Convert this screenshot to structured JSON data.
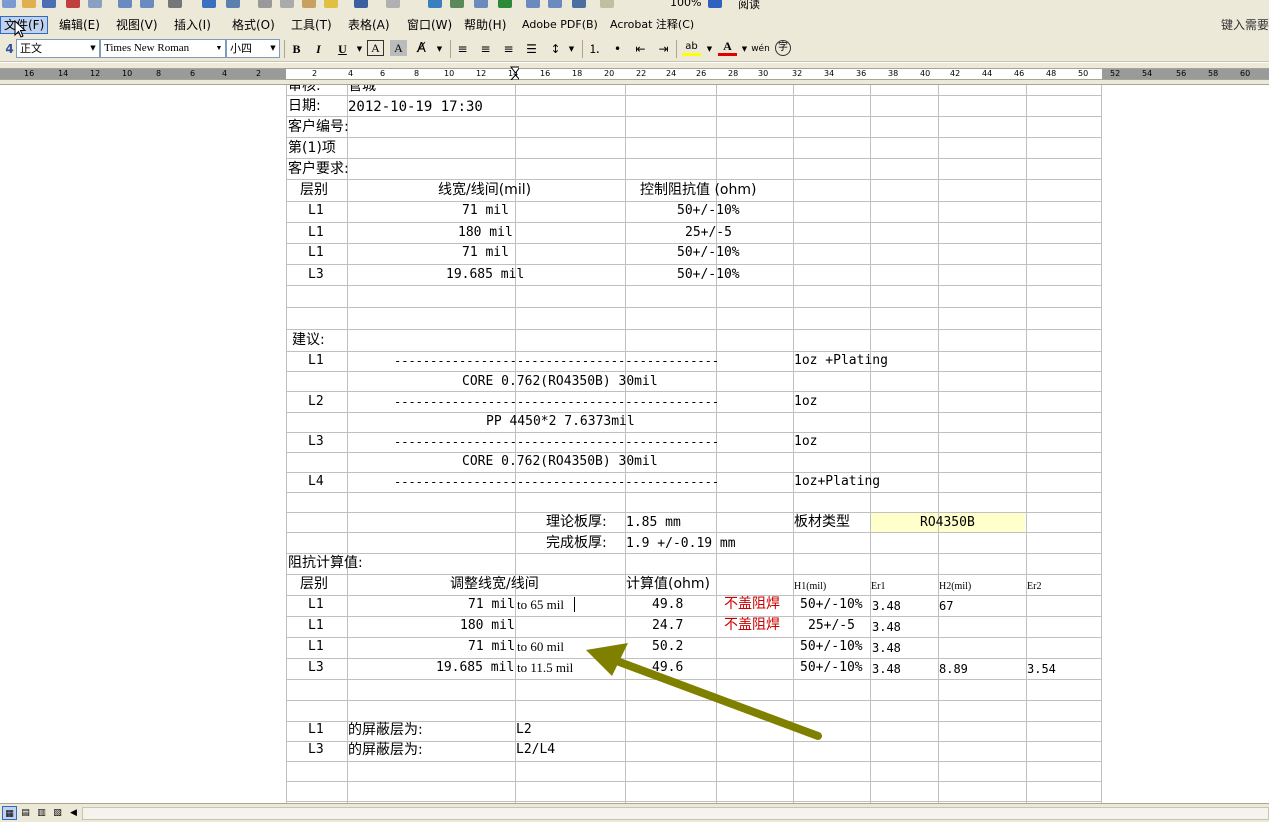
{
  "toolbar_top": {
    "zoom": "100%",
    "reading_label": "阅读"
  },
  "menubar": {
    "items": [
      {
        "label": "文件(F)"
      },
      {
        "label": "编辑(E)"
      },
      {
        "label": "视图(V)"
      },
      {
        "label": "插入(I)"
      },
      {
        "label": "格式(O)"
      },
      {
        "label": "工具(T)"
      },
      {
        "label": "表格(A)"
      },
      {
        "label": "窗口(W)"
      },
      {
        "label": "帮助(H)"
      },
      {
        "label": "Adobe PDF(B)"
      },
      {
        "label": "Acrobat 注释(C)"
      }
    ],
    "ask_placeholder": "键入需要"
  },
  "format_toolbar": {
    "style": "正文",
    "font": "Times New Roman",
    "size": "小四",
    "bold": "B",
    "italic": "I",
    "underline": "U",
    "char_border": "A",
    "char_shade": "A",
    "font_color": "A",
    "phonetic": "wén",
    "enclose": "字"
  },
  "ruler": {
    "ticks": [
      "16",
      "14",
      "12",
      "10",
      "8",
      "6",
      "4",
      "2",
      "2",
      "4",
      "6",
      "8",
      "10",
      "12",
      "14",
      "16",
      "18",
      "20",
      "22",
      "24",
      "26",
      "28",
      "30",
      "32",
      "34",
      "36",
      "38",
      "40",
      "42",
      "44",
      "46",
      "48",
      "50",
      "52",
      "54",
      "56",
      "58",
      "60"
    ]
  },
  "document": {
    "reviewer_label": "审核:",
    "reviewer_value": "管城",
    "date_label": "日期:",
    "date_value": "2012-10-19 17:30",
    "customer_no_label": "客户编号:",
    "item_label": "第(1)项",
    "customer_req_label": "客户要求:",
    "req_headers": [
      "层别",
      "线宽/线间(mil)",
      "控制阻抗值 (ohm)"
    ],
    "req_rows": [
      {
        "layer": "L1",
        "width": "71 mil",
        "impedance": "50+/-10%"
      },
      {
        "layer": "L1",
        "width": "180 mil",
        "impedance": "25+/-5"
      },
      {
        "layer": "L1",
        "width": "71 mil",
        "impedance": "50+/-10%"
      },
      {
        "layer": "L3",
        "width": "19.685 mil",
        "impedance": "50+/-10%"
      }
    ],
    "suggest_label": "建议:",
    "stackup": [
      {
        "layer": "L1",
        "line": "---------------------------------------------",
        "copper": "1oz +Plating"
      },
      {
        "material": "CORE  0.762(RO4350B)  30mil"
      },
      {
        "layer": "L2",
        "line": "---------------------------------------------",
        "copper": "1oz"
      },
      {
        "material": "PP  4450*2  7.6373mil"
      },
      {
        "layer": "L3",
        "line": "---------------------------------------------",
        "copper": "1oz"
      },
      {
        "material": "CORE  0.762(RO4350B)  30mil"
      },
      {
        "layer": "L4",
        "line": "---------------------------------------------",
        "copper": "1oz+Plating"
      }
    ],
    "theory_thickness_label": "理论板厚:",
    "theory_thickness_value": "1.85 mm",
    "board_type_label": "板材类型",
    "board_type_value": "RO4350B",
    "finish_thickness_label": "完成板厚:",
    "finish_thickness_value": "1.9 +/-0.19 mm",
    "calc_label": "阻抗计算值:",
    "calc_headers": [
      "层别",
      "调整线宽/线间",
      "计算值(ohm)",
      "H1(mil)",
      "Er1",
      "H2(mil)",
      "Er2"
    ],
    "calc_rows": [
      {
        "layer": "L1",
        "width": "71 mil",
        "adjust": "to 65 mil",
        "value": "49.8",
        "note": "不盖阻焊",
        "target": "50+/-10%",
        "er1": "3.48",
        "h2": "67",
        "er2": ""
      },
      {
        "layer": "L1",
        "width": "180 mil",
        "adjust": "",
        "value": "24.7",
        "note": "不盖阻焊",
        "target": "25+/-5",
        "er1": "3.48",
        "h2": "",
        "er2": ""
      },
      {
        "layer": "L1",
        "width": "71 mil",
        "adjust": "to 60 mil",
        "value": "50.2",
        "note": "",
        "target": "50+/-10%",
        "er1": "3.48",
        "h2": "",
        "er2": ""
      },
      {
        "layer": "L3",
        "width": "19.685 mil",
        "adjust": "to 11.5 mil",
        "value": "49.6",
        "note": "",
        "target": "50+/-10%",
        "er1": "3.48",
        "h2": "8.89",
        "er2": "3.54"
      }
    ],
    "shield_rows": [
      {
        "layer": "L1",
        "label": "的屏蔽层为:",
        "value": "L2"
      },
      {
        "layer": "L3",
        "label": "的屏蔽层为:",
        "value": "L2/L4"
      }
    ]
  },
  "colors": {
    "chrome": "#ece9d8",
    "arrow": "#808000",
    "note_red": "#cc0000",
    "highlight_yellow": "#ffffcc"
  }
}
